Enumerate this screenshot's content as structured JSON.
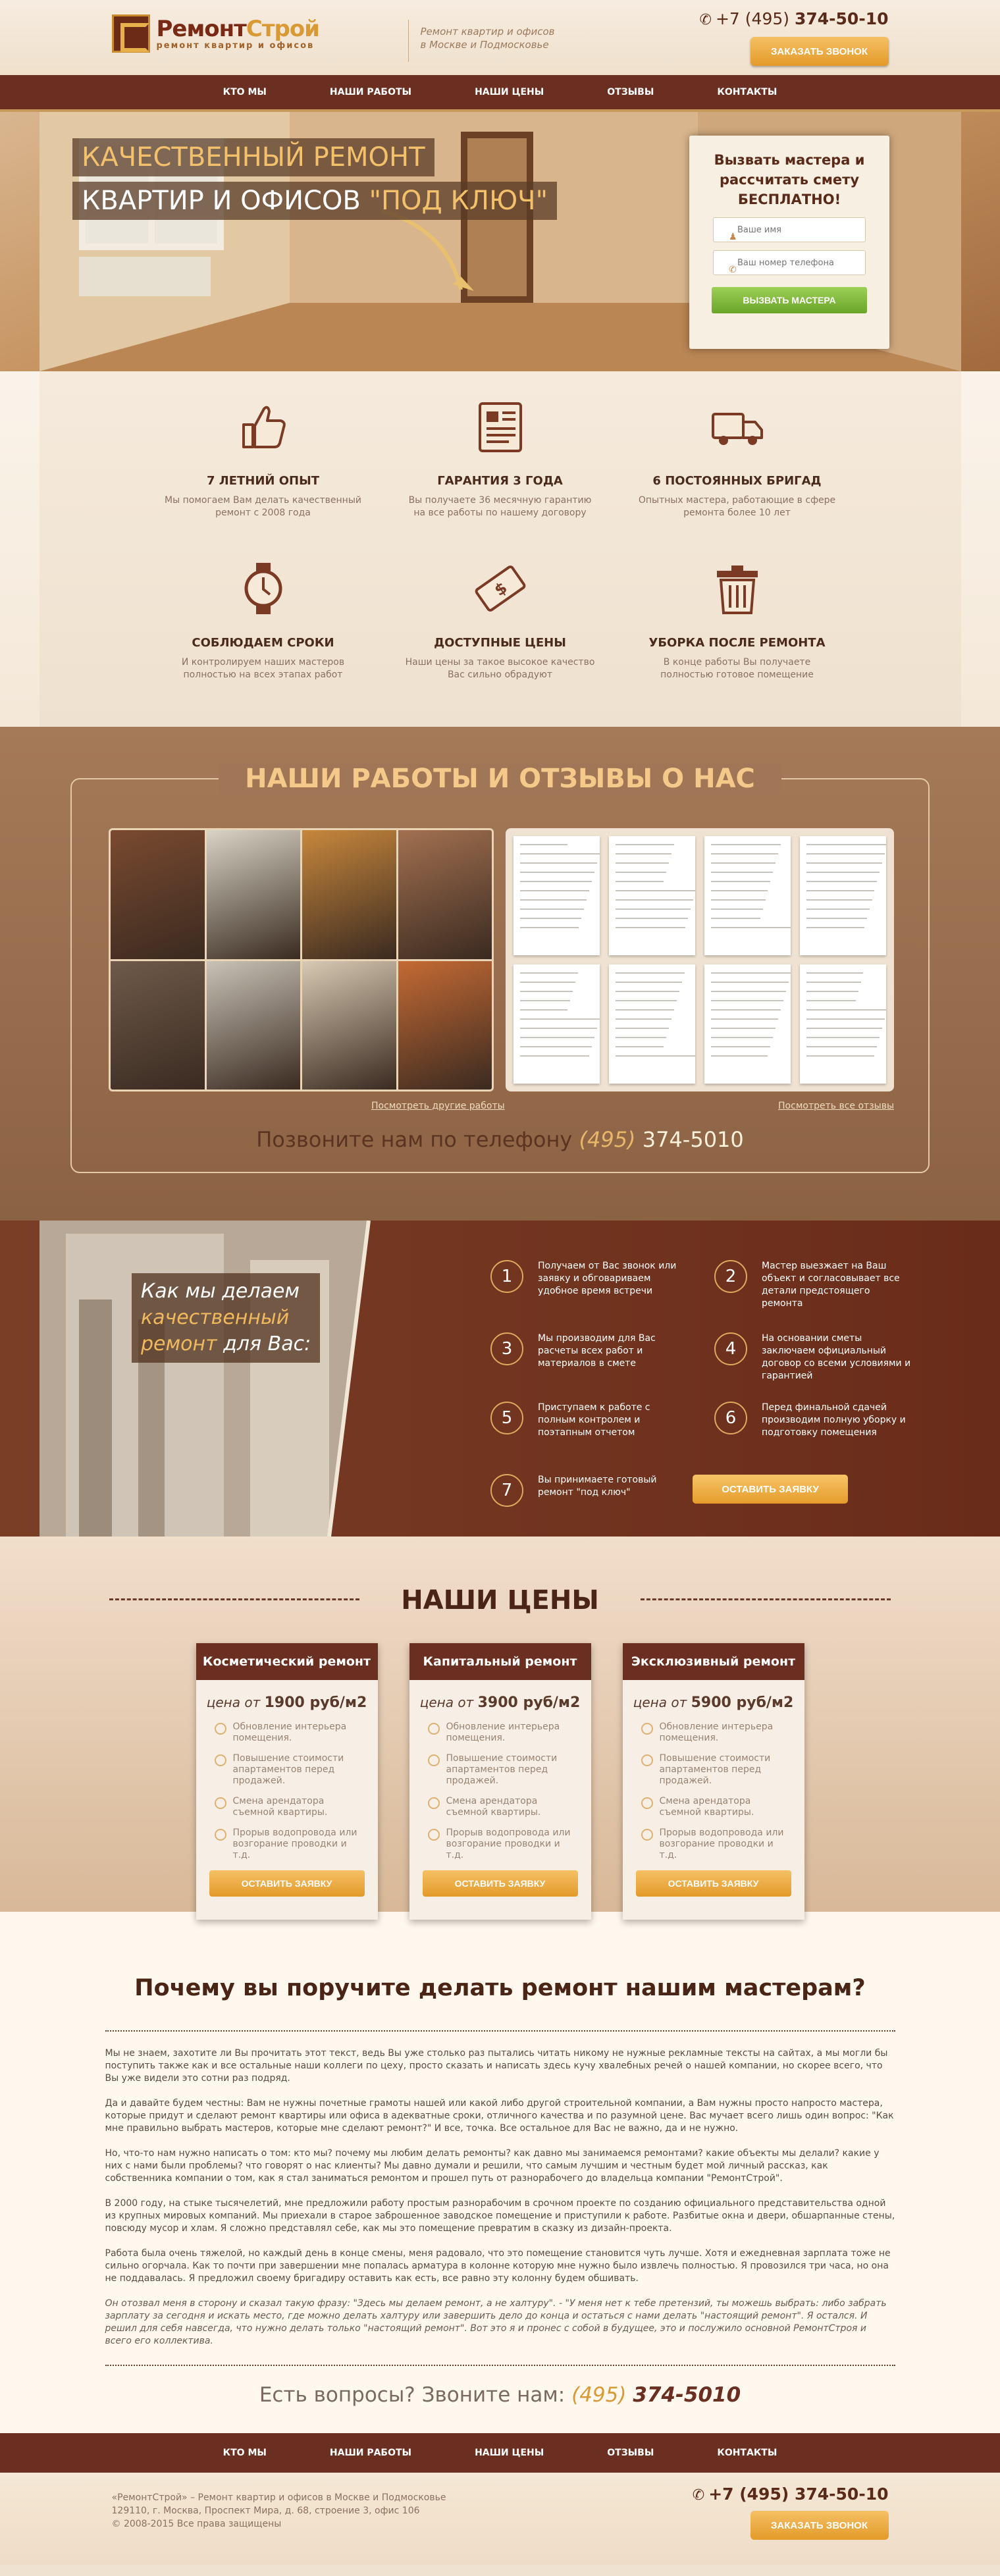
{
  "header": {
    "logo_main": "Ремонт",
    "logo_accent": "Строй",
    "logo_sub": "ремонт квартир и офисов",
    "tagline_line1": "Ремонт квартир и офисов",
    "tagline_line2": "в Москве и Подмосковье",
    "phone_code": "+7 (495)",
    "phone_number": "374-50-10",
    "call_button": "ЗАКАЗАТЬ ЗВОНОК"
  },
  "nav": {
    "items": [
      "КТО МЫ",
      "НАШИ РАБОТЫ",
      "НАШИ ЦЕНЫ",
      "ОТЗЫВЫ",
      "КОНТАКТЫ"
    ]
  },
  "hero": {
    "title_line1": "КАЧЕСТВЕННЫЙ РЕМОНТ",
    "title_line2": "КВАРТИР И ОФИСОВ",
    "title_accent": "\"ПОД КЛЮЧ\"",
    "form_title": "Вызвать мастера и рассчитать смету БЕСПЛАТНО!",
    "name_placeholder": "Ваше имя",
    "phone_placeholder": "Ваш номер телефона",
    "submit": "ВЫЗВАТЬ МАСТЕРА"
  },
  "features": [
    {
      "icon": "thumbs-up-icon",
      "title": "7 ЛЕТНИЙ ОПЫТ",
      "text": "Мы помогаем Вам делать качественный ремонт с 2008 года"
    },
    {
      "icon": "document-icon",
      "title": "ГАРАНТИЯ 3 ГОДА",
      "text": "Вы получаете 36 месячную гарантию на все работы по нашему договору"
    },
    {
      "icon": "truck-icon",
      "title": "6 ПОСТОЯННЫХ БРИГАД",
      "text": "Опытных мастера, работающие в сфере ремонта более 10 лет"
    },
    {
      "icon": "watch-icon",
      "title": "СОБЛЮДАЕМ СРОКИ",
      "text": "И контролируем наших мастеров полностью на всех этапах работ"
    },
    {
      "icon": "money-icon",
      "title": "ДОСТУПНЫЕ ЦЕНЫ",
      "text": "Наши цены за такое высокое качество Вас сильно обрадуют"
    },
    {
      "icon": "trash-bin-icon",
      "title": "УБОРКА ПОСЛЕ РЕМОНТА",
      "text": "В конце работы Вы получаете полностью готовое помещение"
    }
  ],
  "works": {
    "title": "НАШИ РАБОТЫ И ОТЗЫВЫ О НАС",
    "photos_link": "Посмотреть другие работы",
    "reviews_link": "Посмотреть все отзывы",
    "phone_label": "Позвоните нам по телефону",
    "phone_code": "(495)",
    "phone_number": "374-5010",
    "photo_colors": [
      "#7a4a30",
      "#d8d4c6",
      "#c7873c",
      "#a27050",
      "#6e5a4a",
      "#c9c2b6",
      "#d7c9b3",
      "#c46a34"
    ]
  },
  "steps": {
    "title_pre": "Как мы делаем",
    "title_accent1": "качественный",
    "title_accent2": "ремонт",
    "title_post": "для Вас:",
    "items": [
      {
        "n": "1",
        "text": "Получаем от Вас звонок или заявку и обговариваем удобное время встречи"
      },
      {
        "n": "2",
        "text": "Мастер выезжает на Ваш объект и согласовывает все детали предстоящего ремонта"
      },
      {
        "n": "3",
        "text": "Мы производим для Вас расчеты всех работ и материалов в смете"
      },
      {
        "n": "4",
        "text": "На основании сметы заключаем официальный договор со всеми условиями и гарантией"
      },
      {
        "n": "5",
        "text": "Приступаем к работе с полным контролем и поэтапным отчетом"
      },
      {
        "n": "6",
        "text": "Перед финальной сдачей производим полную уборку и подготовку помещения"
      },
      {
        "n": "7",
        "text": "Вы принимаете готовый ремонт \"под ключ\""
      }
    ],
    "button": "ОСТАВИТЬ ЗАЯВКУ"
  },
  "prices": {
    "title": "НАШИ ЦЕНЫ",
    "price_prefix": "цена от",
    "cards": [
      {
        "title": "Косметический ремонт",
        "price": "1900 руб/м2"
      },
      {
        "title": "Капитальный ремонт",
        "price": "3900 руб/м2"
      },
      {
        "title": "Эксклюзивный ремонт",
        "price": "5900 руб/м2"
      }
    ],
    "bullets": [
      "Обновление интерьера помещения.",
      "Повышение стоимости апартаментов перед продажей.",
      "Смена арендатора съемной квартиры.",
      "Прорыв водопровода или возгорание проводки и т.д."
    ],
    "button": "ОСТАВИТЬ ЗАЯВКУ"
  },
  "why": {
    "title": "Почему вы поручите делать ремонт нашим мастерам?",
    "paragraphs": [
      "Мы не знаем, захотите ли Вы прочитать этот текст, ведь Вы уже столько раз пытались читать никому не нужные рекламные тексты на сайтах, а мы могли бы поступить также как и все остальные наши коллеги по цеху, просто сказать и написать здесь кучу хвалебных речей о нашей компании, но скорее всего, что Вы уже видели это сотни раз подряд.",
      "Да и давайте будем честны: Вам не нужны почетные грамоты нашей или какой либо другой строительной компании, а Вам нужны просто напросто мастера, которые придут и сделают ремонт квартиры или офиса в адекватные сроки, отличного качества и по разумной цене. Вас мучает всего лишь один вопрос: \"Как мне правильно выбрать мастеров, которые мне сделают ремонт?\" И все, точка. Все остальное для Вас не важно, да и не нужно.",
      "Но, что-то нам нужно написать о том: кто мы? почему мы любим делать ремонты? как давно мы занимаемся ремонтами? какие объекты мы делали? какие у них с нами были проблемы? что говорят о нас клиенты? Мы давно думали и решили, что самым лучшим и честным будет мой личный рассказ, как собственника компании о том, как я стал заниматься ремонтом и прошел путь от разнорабочего до владельца компании \"РемонтСтрой\".",
      "В 2000 году, на стыке тысячелетий, мне предложили работу простым разнорабочим в срочном проекте по созданию официального представительства одной из крупных мировых компаний. Мы приехали в старое заброшенное заводское помещение и приступили к работе. Разбитые окна и двери, обшарпанные стены, повсюду мусор и хлам. Я сложно представлял себе, как мы это помещение превратим в сказку из дизайн-проекта.",
      "Работа была очень тяжелой, но каждый день в конце смены, меня радовало, что это помещение становится чуть лучше. Хотя и ежедневная зарплата тоже не сильно огорчала. Как то почти при завершении мне попалась арматура в колонне которую мне нужно было извлечь полностью. Я провозился три часа, но она не поддавалась. Я предложил своему бригадиру оставить как есть, все равно эту колонну будем обшивать.",
      "Он отозвал меня в сторону и сказал такую фразу: \"Здесь мы делаем ремонт, а не халтуру\". - \"У меня нет к тебе претензий, ты можешь выбрать: либо забрать зарплату за сегодня и искать место, где можно делать халтуру или завершить дело до конца и остаться с нами делать \"настоящий ремонт\". Я остался. И решил для себя навсегда, что нужно делать только \"настоящий ремонт\". Вот это я и пронес с собой в будущее, это и послужило основной РемонтСтроя и всего его коллектива."
    ],
    "question": "Есть вопросы? Звоните нам:",
    "phone_code": "(495)",
    "phone_number": "374-5010"
  },
  "footer": {
    "info_line1": "«РемонтСтрой» – Ремонт квартир и офисов в Москве и Подмосковье",
    "info_line2": "129110, г. Москва, Проспект Мира, д. 68, строение 3, офис 106",
    "info_line3": "© 2008-2015 Все права защищены",
    "phone": "+7 (495) 374-50-10",
    "call_button": "ЗАКАЗАТЬ ЗВОНОК"
  }
}
